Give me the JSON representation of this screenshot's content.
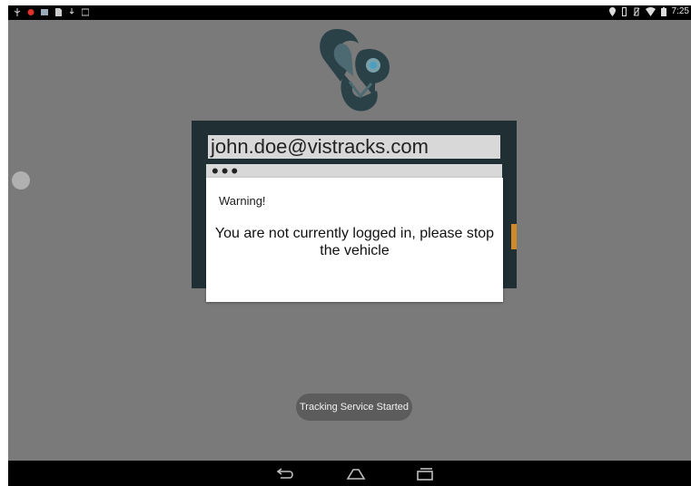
{
  "status_bar": {
    "left_icons": [
      "usb-icon",
      "notification-dot-icon",
      "app-notification-icon",
      "sd-card-icon",
      "download-icon",
      "gallery-icon"
    ],
    "right_icons": [
      "location-icon",
      "vibrate-icon",
      "no-sim-icon",
      "wifi-icon",
      "battery-icon"
    ],
    "time": "7:25"
  },
  "login": {
    "email_value": "john.doe@vistracks.com",
    "password_value": "•••"
  },
  "dialog": {
    "title": "Warning!",
    "message": "You are not currently logged in, please stop the vehicle"
  },
  "toast": {
    "text": "Tracking Service Started"
  },
  "nav_bar": {
    "buttons": [
      "back-icon",
      "home-icon",
      "recents-icon"
    ]
  },
  "colors": {
    "background_dim": "#7a7a7a",
    "panel": "#1f2f33",
    "logo_dark": "#2a4148",
    "accent_blue": "#4a9fc0",
    "toast_bg": "#5c5c5c"
  }
}
